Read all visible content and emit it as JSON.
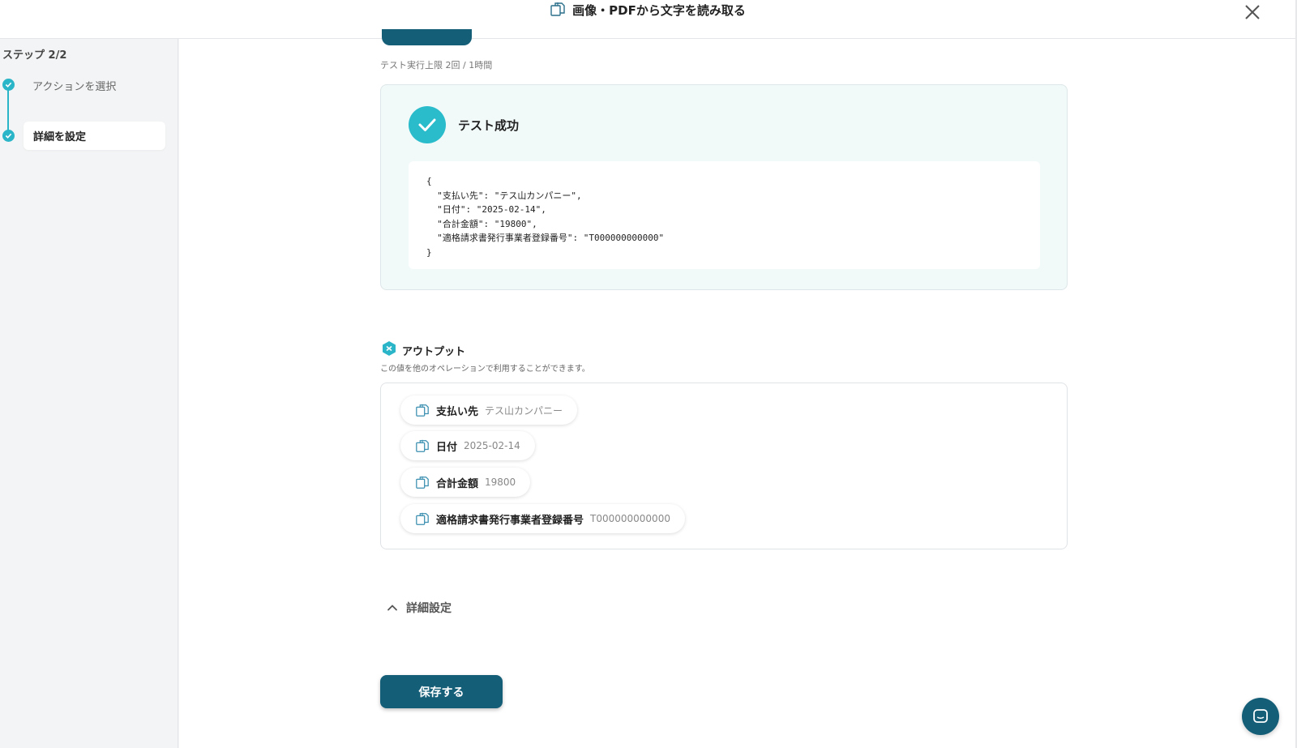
{
  "header": {
    "title": "画像・PDFから文字を読み取る",
    "title_icon": "document-scan-icon",
    "close_icon": "close-icon"
  },
  "sidebar": {
    "step_label": "ステップ 2/2",
    "steps": [
      {
        "label": "アクションを選択",
        "status": "complete"
      },
      {
        "label": "詳細を設定",
        "status": "active"
      }
    ]
  },
  "main": {
    "test_limit": "テスト実行上限 2回 / 1時間",
    "success": {
      "title": "テスト成功",
      "json_output": "{\n  \"支払い先\": \"テス山カンパニー\",\n  \"日付\": \"2025-02-14\",\n  \"合計金額\": \"19800\",\n  \"適格請求書発行事業者登録番号\": \"T000000000000\"\n}"
    },
    "output": {
      "title": "アウトプット",
      "description": "この値を他のオペレーションで利用することができます。",
      "items": [
        {
          "label": "支払い先",
          "value": "テス山カンパニー"
        },
        {
          "label": "日付",
          "value": "2025-02-14"
        },
        {
          "label": "合計金額",
          "value": "19800"
        },
        {
          "label": "適格請求書発行事業者登録番号",
          "value": "T000000000000"
        }
      ]
    },
    "advanced_settings": "詳細設定",
    "save_button": "保存する"
  },
  "colors": {
    "accent": "#2bb5c8",
    "primary_button": "#145e78",
    "success_bg": "#f2f9f9"
  }
}
